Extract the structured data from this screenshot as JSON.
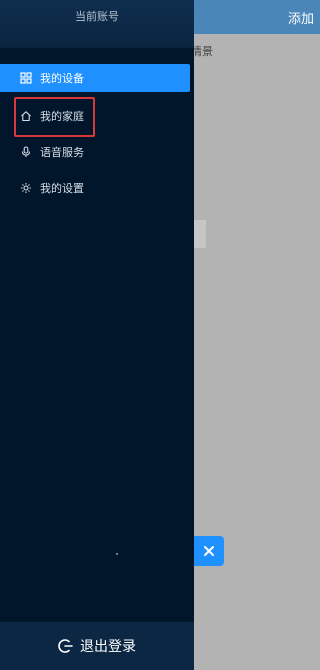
{
  "background_app": {
    "header_action": "添加",
    "partial_scene_text": "景情景",
    "close_icon": "close-icon"
  },
  "drawer": {
    "account_title": "当前账号",
    "menu": [
      {
        "label": "我的设备",
        "icon": "grid-icon",
        "active": true
      },
      {
        "label": "我的家庭",
        "icon": "home-icon",
        "active": false
      },
      {
        "label": "语音服务",
        "icon": "microphone-icon",
        "active": false
      },
      {
        "label": "我的设置",
        "icon": "gear-icon",
        "active": false
      }
    ],
    "logout_label": "退出登录",
    "logout_icon": "logout-icon"
  },
  "colors": {
    "accent": "#1e90ff",
    "drawer_bg": "#02162b",
    "highlight_border": "#d83a3a"
  }
}
